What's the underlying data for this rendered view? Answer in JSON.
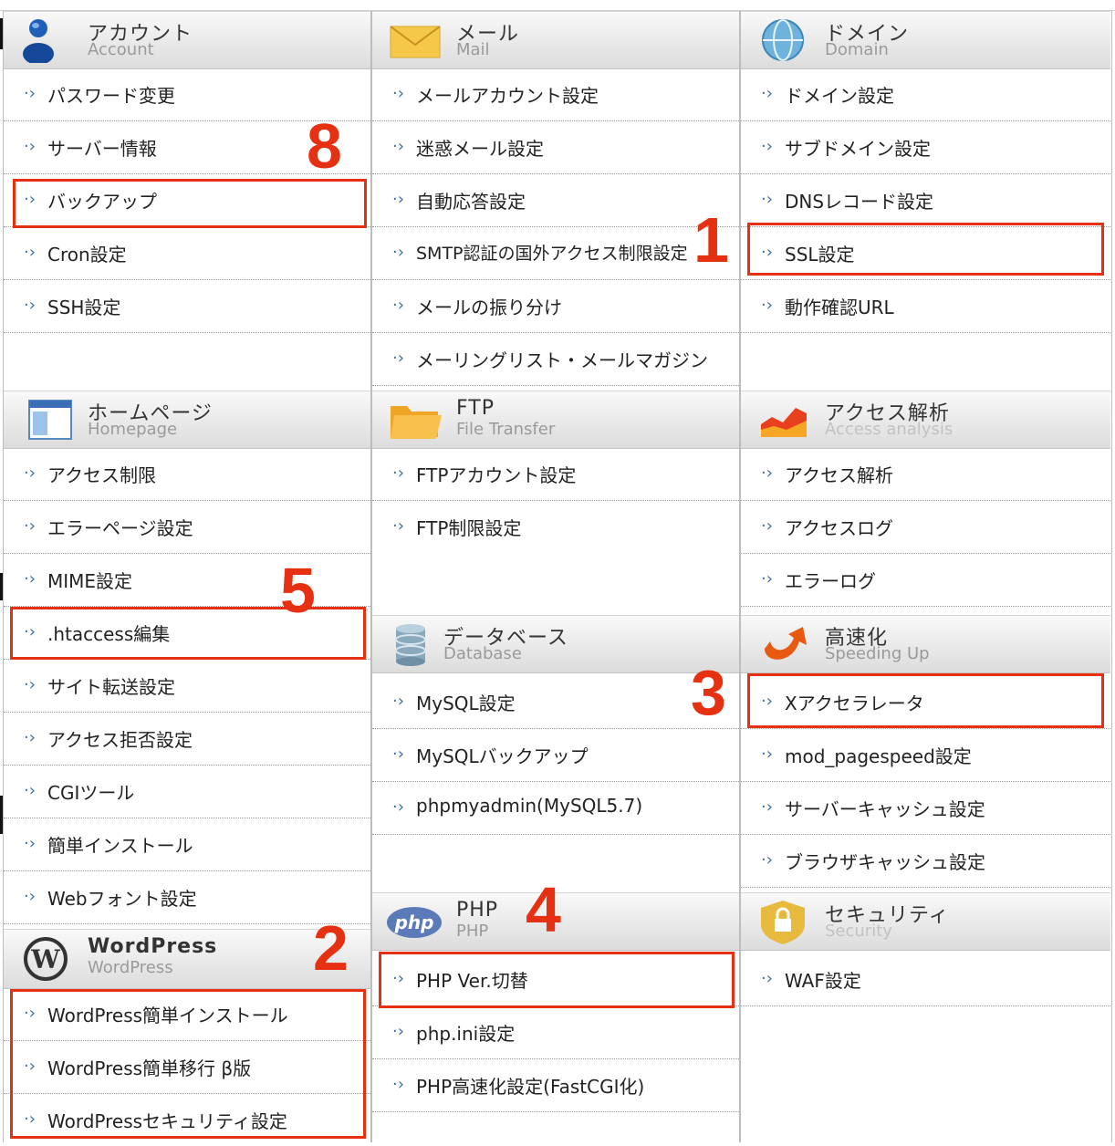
{
  "sections": {
    "account": {
      "title_ja": "アカウント",
      "title_en": "Account",
      "icon": "account-person-icon",
      "items": [
        "パスワード変更",
        "サーバー情報",
        "バックアップ",
        "Cron設定",
        "SSH設定"
      ]
    },
    "mail": {
      "title_ja": "メール",
      "title_en": "Mail",
      "icon": "envelope-icon",
      "items": [
        "メールアカウント設定",
        "迷惑メール設定",
        "自動応答設定",
        "SMTP認証の国外アクセス制限設定",
        "メールの振り分け",
        "メーリングリスト・メールマガジン"
      ]
    },
    "domain": {
      "title_ja": "ドメイン",
      "title_en": "Domain",
      "icon": "globe-icon",
      "items": [
        "ドメイン設定",
        "サブドメイン設定",
        "DNSレコード設定",
        "SSL設定",
        "動作確認URL"
      ]
    },
    "homepage": {
      "title_ja": "ホームページ",
      "title_en": "Homepage",
      "icon": "browser-window-icon",
      "items": [
        "アクセス制限",
        "エラーページ設定",
        "MIME設定",
        ".htaccess編集",
        "サイト転送設定",
        "アクセス拒否設定",
        "CGIツール",
        "簡単インストール",
        "Webフォント設定"
      ]
    },
    "ftp": {
      "title_ja": "FTP",
      "title_en": "File Transfer",
      "icon": "folder-icon",
      "items": [
        "FTPアカウント設定",
        "FTP制限設定"
      ]
    },
    "access": {
      "title_ja": "アクセス解析",
      "title_en": "Access analysis",
      "icon": "area-chart-icon",
      "items": [
        "アクセス解析",
        "アクセスログ",
        "エラーログ"
      ]
    },
    "database": {
      "title_ja": "データベース",
      "title_en": "Database",
      "icon": "database-cylinder-icon",
      "items": [
        "MySQL設定",
        "MySQLバックアップ",
        "phpmyadmin(MySQL5.7)"
      ]
    },
    "speed": {
      "title_ja": "高速化",
      "title_en": "Speeding Up",
      "icon": "speed-arrow-icon",
      "items": [
        "Xアクセラレータ",
        "mod_pagespeed設定",
        "サーバーキャッシュ設定",
        "ブラウザキャッシュ設定"
      ]
    },
    "wordpress": {
      "title_ja": "WordPress",
      "title_en": "WordPress",
      "icon": "wordpress-logo-icon",
      "items": [
        "WordPress簡単インストール",
        "WordPress簡単移行 β版",
        "WordPressセキュリティ設定"
      ]
    },
    "php": {
      "title_ja": "PHP",
      "title_en": "PHP",
      "icon": "php-logo-icon",
      "icon_text": "php",
      "items": [
        "PHP Ver.切替",
        "php.ini設定",
        "PHP高速化設定(FastCGI化)"
      ]
    },
    "security": {
      "title_ja": "セキュリティ",
      "title_en": "Security",
      "icon": "padlock-icon",
      "items": [
        "WAF設定"
      ]
    }
  },
  "annotations": [
    "1",
    "2",
    "3",
    "4",
    "5",
    "8"
  ],
  "colors": {
    "highlight": "#e53012",
    "arrow": "#3c6fa0"
  }
}
